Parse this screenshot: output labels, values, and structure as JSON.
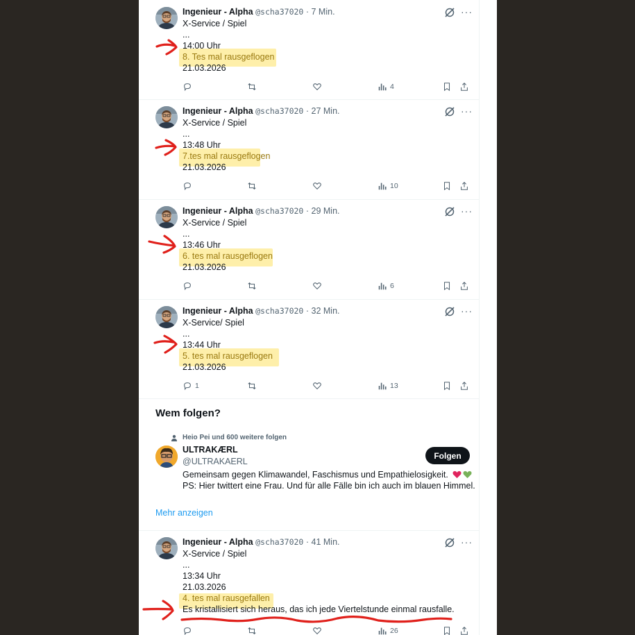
{
  "tweets": [
    {
      "name": "Ingenieur - Alpha",
      "handle": "@scha37020",
      "dot": "·",
      "time": "7 Min.",
      "app": "X-Service / Spiel",
      "ellipsis": "...",
      "clock": "14:00 Uhr",
      "count_text": "8. Tes mal rausgeflogen",
      "date": "21.03.2026",
      "replies": "",
      "views": "4"
    },
    {
      "name": "Ingenieur - Alpha",
      "handle": "@scha37020",
      "dot": "·",
      "time": "27 Min.",
      "app": "X-Service / Spiel",
      "ellipsis": "...",
      "clock": "13:48 Uhr",
      "count_text": "7.tes mal rausgeflogen",
      "date": "21.03.2026",
      "replies": "",
      "views": "10"
    },
    {
      "name": "Ingenieur - Alpha",
      "handle": "@scha37020",
      "dot": "·",
      "time": "29 Min.",
      "app": "X-Service / Spiel",
      "ellipsis": "...",
      "clock": "13:46 Uhr",
      "count_text": "6. tes mal rausgeflogen",
      "date": "21.03.2026",
      "replies": "",
      "views": "6"
    },
    {
      "name": "Ingenieur - Alpha",
      "handle": "@scha37020",
      "dot": "·",
      "time": "32 Min.",
      "app": "X-Service/ Spiel",
      "ellipsis": "...",
      "clock": "13:44 Uhr",
      "count_text": "5. tes mal rausgeflogen",
      "date": "21.03.2026",
      "replies": "1",
      "views": "13"
    },
    {
      "name": "Ingenieur - Alpha",
      "handle": "@scha37020",
      "dot": "·",
      "time": "41 Min.",
      "app": "X-Service / Spiel",
      "ellipsis": "...",
      "clock": "13:34 Uhr",
      "count_text": "4. tes mal rausgefallen",
      "date": "21.03.2026",
      "note": "Es kristallisiert sich heraus, das ich jede Viertelstunde einmal rausfalle.",
      "replies": "",
      "views": "26"
    }
  ],
  "who_to_follow": {
    "title": "Wem folgen?",
    "social_context": "Heio Pei und 600 weitere folgen",
    "name": "ULTRAKÆRL",
    "handle": "@ULTRAKAERL",
    "bio_line1": "Gemeinsam gegen Klimawandel, Faschismus und Empathielosigkeit.",
    "bio_line2": "PS: Hier twittert eine Frau. Und für alle Fälle bin ich auch im blauen Himmel.",
    "follow_label": "Folgen",
    "more_label": "Mehr anzeigen"
  },
  "colors": {
    "highlight": "#fde98e",
    "ink": "#e0201b",
    "link": "#1d9bf0",
    "text": "#0f1419",
    "muted": "#536471"
  },
  "icons": [
    "grok-icon",
    "more-icon",
    "reply-icon",
    "retweet-icon",
    "like-icon",
    "views-icon",
    "bookmark-icon",
    "share-icon",
    "person-icon",
    "heart-red-icon",
    "heart-green-icon"
  ]
}
